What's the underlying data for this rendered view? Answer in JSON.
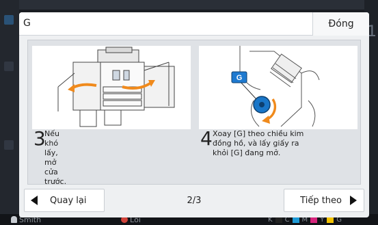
{
  "dialog": {
    "title": "G",
    "close_label": "Đóng"
  },
  "steps": [
    {
      "number": "3",
      "text": "Nếu khó\nlấy, mở\ncửa trước."
    },
    {
      "number": "4",
      "text": "Xoay [G] theo chiều kim\nđồng hồ, và lấy giấy ra\nkhỏi [G] đang mở."
    }
  ],
  "illustration": {
    "callout_label": "G",
    "arrow_color": "#f08a1c",
    "knob_color": "#1976c8"
  },
  "footer": {
    "back_label": "Quay lại",
    "page_indicator": "2/3",
    "next_label": "Tiếp theo"
  },
  "background": {
    "user_name": "Smith",
    "error_label": "Lỗi",
    "ink_labels": [
      "K",
      "C",
      "M",
      "Y",
      "G"
    ],
    "ink_colors": [
      "#222222",
      "#1e9ad6",
      "#d6247c",
      "#f2c200",
      "#9aa0a6"
    ],
    "right_digit": "1"
  }
}
